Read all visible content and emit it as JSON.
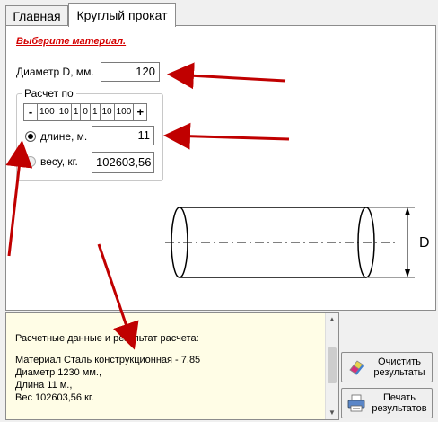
{
  "tabs": [
    {
      "label": "Главная"
    },
    {
      "label": "Круглый прокат"
    }
  ],
  "material_prompt": "Выберите материал.",
  "diameter": {
    "label": "Диаметр D, мм.",
    "value": "120"
  },
  "calc_group": {
    "title": "Расчет по",
    "stepper": [
      "-",
      "100",
      "10",
      "1",
      "0",
      "1",
      "10",
      "100",
      "+"
    ],
    "length": {
      "label": "длине, м.",
      "value": "11",
      "checked": true
    },
    "weight": {
      "label": "весу, кг.",
      "value": "102603,56",
      "checked": false
    }
  },
  "drawing": {
    "dimension_label": "D"
  },
  "results": {
    "lines": [
      "Расчетные данные и результат расчета:",
      "",
      "Материал Сталь конструкционная - 7,85",
      "Диаметр 1230 мм.,",
      "Длина 11 м.,",
      "Вес 102603,56 кг."
    ]
  },
  "buttons": {
    "clear": "Очистить\nрезультаты",
    "print": "Печать\nрезультатов"
  },
  "colors": {
    "arrow": "#c00000",
    "highlight": "#d40000",
    "results_bg": "#fffde6"
  }
}
